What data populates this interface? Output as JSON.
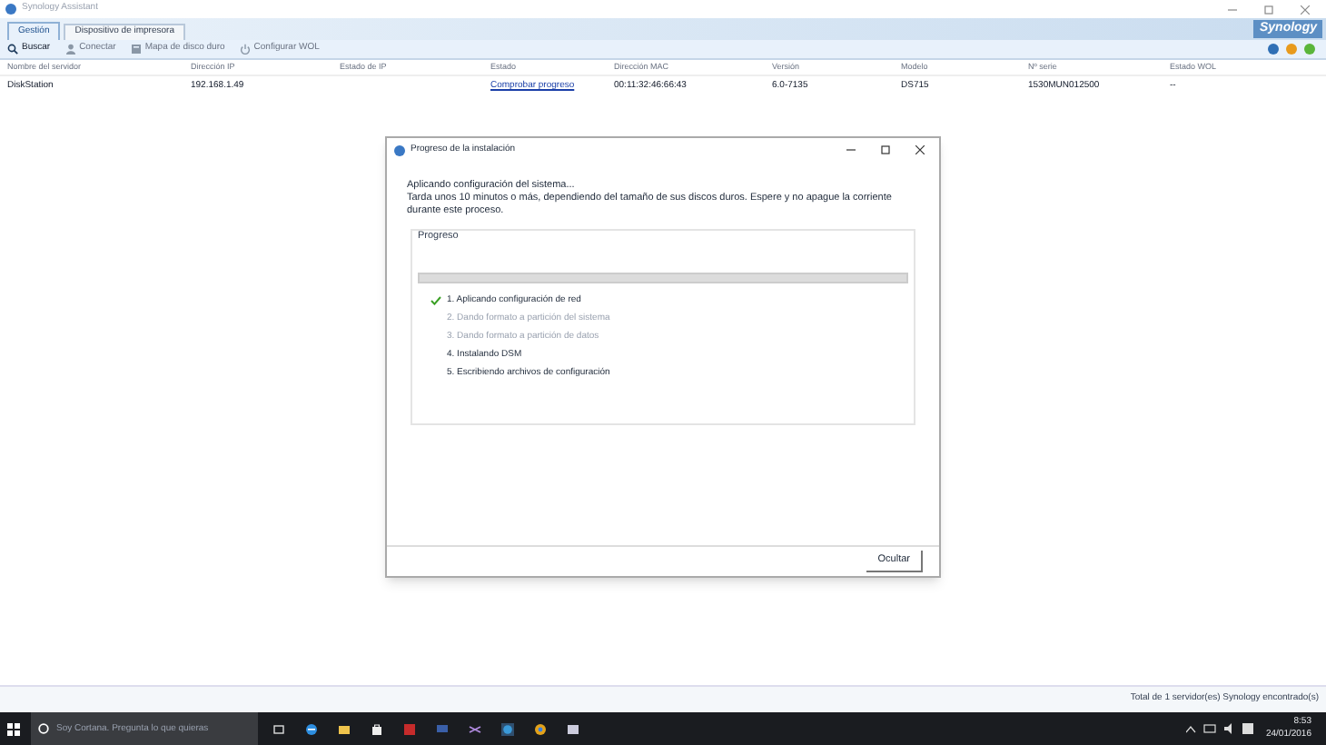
{
  "window": {
    "title": "Synology Assistant"
  },
  "logo": "Synology",
  "tabs": [
    {
      "label": "Gestión",
      "selected": true
    },
    {
      "label": "Dispositivo de impresora",
      "selected": false
    }
  ],
  "toolbar": [
    {
      "label": "Buscar",
      "kind": "search",
      "disabled": false
    },
    {
      "label": "Conectar",
      "kind": "connect",
      "disabled": true
    },
    {
      "label": "Mapa de disco duro",
      "kind": "map",
      "disabled": true
    },
    {
      "label": "Configurar WOL",
      "kind": "wol",
      "disabled": true
    }
  ],
  "table": {
    "columns": [
      "Nombre del servidor",
      "Dirección IP",
      "Estado de IP",
      "Estado",
      "Dirección MAC",
      "Versión",
      "Modelo",
      "Nº serie",
      "Estado WOL"
    ],
    "rows": [
      {
        "cells": [
          "DiskStation",
          "192.168.1.49",
          "",
          "Comprobar progreso",
          "00:11:32:46:66:43",
          "6.0-7135",
          "DS715",
          "1530MUN012500",
          "--"
        ],
        "selected": false
      }
    ]
  },
  "status_bar": "Total de 1 servidor(es) Synology encontrado(s)",
  "dialog": {
    "title": "Progreso de la instalación",
    "heading": "Aplicando configuración del sistema...",
    "message": "Tarda unos 10 minutos o más, dependiendo del tamaño de sus discos duros. Espere y no apague la corriente durante este proceso.",
    "group_title": "Progreso",
    "progress": {
      "level": 0
    },
    "steps": [
      {
        "label": "1. Aplicando configuración de red",
        "checked": true,
        "disabled": false
      },
      {
        "label": "2. Dando formato a partición del sistema",
        "checked": false,
        "disabled": true
      },
      {
        "label": "3. Dando formato a partición de datos",
        "checked": false,
        "disabled": true
      },
      {
        "label": "4. Instalando DSM",
        "checked": false,
        "disabled": false
      },
      {
        "label": "5. Escribiendo archivos de configuración",
        "checked": false,
        "disabled": false
      }
    ],
    "button": "Ocultar"
  },
  "taskbar": {
    "search_placeholder": "Soy Cortana. Pregunta lo que quieras",
    "time": "8:53",
    "date": "24/01/2016"
  }
}
